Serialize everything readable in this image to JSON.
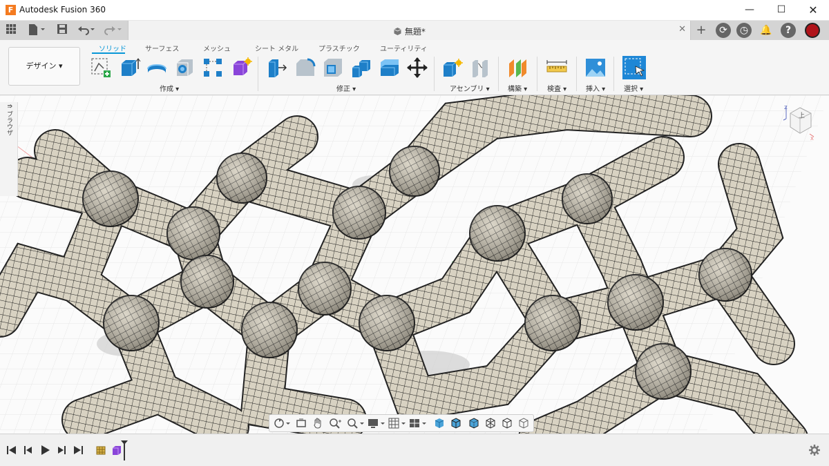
{
  "window": {
    "title": "Autodesk Fusion 360",
    "app_icon": "F"
  },
  "document": {
    "name": "無題*"
  },
  "workspace": {
    "label": "デザイン ▾"
  },
  "tabs": [
    {
      "label": "ソリッド",
      "active": true
    },
    {
      "label": "サーフェス",
      "active": false
    },
    {
      "label": "メッシュ",
      "active": false
    },
    {
      "label": "シート メタル",
      "active": false
    },
    {
      "label": "プラスチック",
      "active": false
    },
    {
      "label": "ユーティリティ",
      "active": false
    }
  ],
  "groups": {
    "create": "作成 ▾",
    "modify": "修正 ▾",
    "assemble": "アセンブリ ▾",
    "construct": "構築 ▾",
    "inspect": "検査 ▾",
    "insert": "挿入 ▾",
    "select": "選択 ▾"
  },
  "browser": {
    "label": "ブラウザ"
  },
  "viewcube": {
    "face": "上"
  },
  "colors": {
    "accent": "#0696d7",
    "mesh": "#d9d3c4",
    "mesh_line": "#1c1c1c",
    "title_icon": "#f47b20"
  }
}
